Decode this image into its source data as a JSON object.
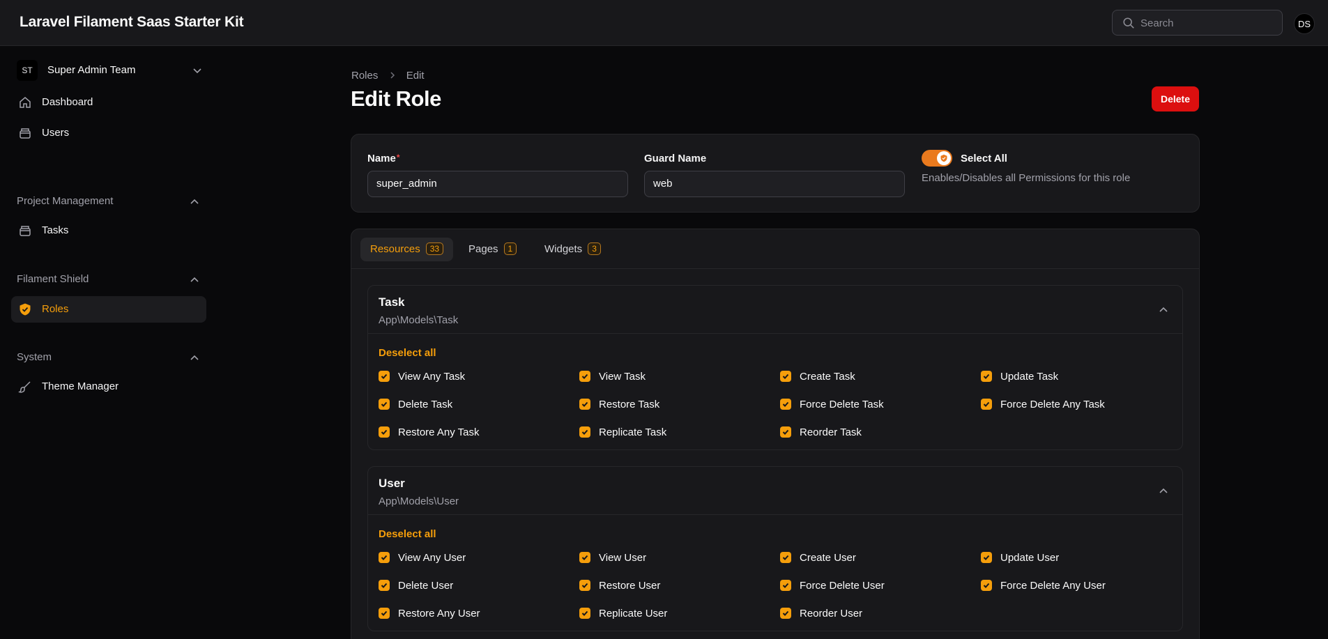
{
  "app": {
    "title": "Laravel Filament Saas Starter Kit",
    "search_placeholder": "Search",
    "user_initials": "DS"
  },
  "sidebar": {
    "team": {
      "initials": "ST",
      "name": "Super Admin Team"
    },
    "items": [
      {
        "label": "Dashboard",
        "icon": "home-icon"
      },
      {
        "label": "Users",
        "icon": "users-icon"
      }
    ],
    "groups": [
      {
        "label": "Project Management",
        "items": [
          {
            "label": "Tasks",
            "icon": "tasks-icon"
          }
        ]
      },
      {
        "label": "Filament Shield",
        "items": [
          {
            "label": "Roles",
            "icon": "shield-icon",
            "active": true
          }
        ]
      },
      {
        "label": "System",
        "items": [
          {
            "label": "Theme Manager",
            "icon": "paintbrush-icon"
          }
        ]
      }
    ]
  },
  "breadcrumb": [
    "Roles",
    "Edit"
  ],
  "page": {
    "title": "Edit Role",
    "delete_label": "Delete"
  },
  "form": {
    "name_label": "Name",
    "name_required": "*",
    "name_value": "super_admin",
    "guard_label": "Guard Name",
    "guard_value": "web",
    "select_all_label": "Select All",
    "select_all_desc": "Enables/Disables all Permissions for this role",
    "select_all_on": true
  },
  "tabs": [
    {
      "label": "Resources",
      "count": "33",
      "active": true
    },
    {
      "label": "Pages",
      "count": "1"
    },
    {
      "label": "Widgets",
      "count": "3"
    }
  ],
  "sections": [
    {
      "title": "Task",
      "subtitle": "App\\Models\\Task",
      "deselect_label": "Deselect all",
      "permissions": [
        "View Any Task",
        "View Task",
        "Create Task",
        "Update Task",
        "Delete Task",
        "Restore Task",
        "Force Delete Task",
        "Force Delete Any Task",
        "Restore Any Task",
        "Replicate Task",
        "Reorder Task"
      ]
    },
    {
      "title": "User",
      "subtitle": "App\\Models\\User",
      "deselect_label": "Deselect all",
      "permissions": [
        "View Any User",
        "View User",
        "Create User",
        "Update User",
        "Delete User",
        "Restore User",
        "Force Delete User",
        "Force Delete Any User",
        "Restore Any User",
        "Replicate User",
        "Reorder User"
      ]
    }
  ],
  "colors": {
    "accent": "#f59e0b",
    "danger": "#dc0f0f",
    "toggle": "#ea7a1e"
  }
}
